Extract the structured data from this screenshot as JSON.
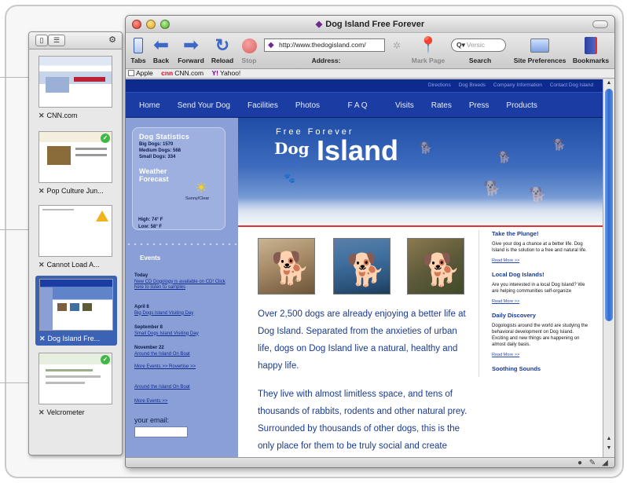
{
  "tabs_drawer": {
    "tabs": [
      {
        "label": "CNN.com",
        "status": "none"
      },
      {
        "label": "Pop Culture Jun...",
        "status": "check"
      },
      {
        "label": "Cannot Load A...",
        "status": "warning"
      },
      {
        "label": "Dog Island Fre...",
        "status": "none",
        "active": true
      },
      {
        "label": "Velcrometer",
        "status": "check"
      }
    ]
  },
  "window": {
    "title": "Dog Island Free Forever"
  },
  "toolbar": {
    "tabs_label": "Tabs",
    "back_label": "Back",
    "forward_label": "Forward",
    "reload_label": "Reload",
    "stop_label": "Stop",
    "address_label": "Address:",
    "address_value": "http://www.thedogisland.com/",
    "markpage_label": "Mark Page",
    "search_label": "Search",
    "search_prefix": "Q▾",
    "search_placeholder": "Versic",
    "siteprefs_label": "Site Preferences",
    "bookmarks_label": "Bookmarks"
  },
  "bookmarks_bar": {
    "items": [
      "Apple",
      "CNN.com",
      "Yahoo!"
    ]
  },
  "site": {
    "top_links": [
      "Directions",
      "Dog Breeds",
      "Company Information",
      "Contact Dog Island"
    ],
    "nav": [
      "Home",
      "Send Your Dog",
      "Facilities",
      "Photos",
      "F A Q",
      "Visits",
      "Rates",
      "Press",
      "Products"
    ],
    "stats_title": "Dog Statistics",
    "stats": [
      "Big Dogs: 1570",
      "Medium Dogs: 568",
      "Small Dogs: 334"
    ],
    "weather_title": "Weather Forecast",
    "weather_condition": "Sunny/Clear",
    "high": "High: 74° F",
    "low": "Low: 58° F",
    "events_title": "Events",
    "events": [
      {
        "date": "Today",
        "text": "New CD Dogology is available on CD! Click here to listen to samples"
      },
      {
        "date": "April 8",
        "text": "Big Dogs Island Visiting Day"
      },
      {
        "date": "September 8",
        "text": "Small Dogs Island Visiting Day"
      },
      {
        "date": "November 22",
        "text": "Around the Island On Boat"
      }
    ],
    "more_events": "More Events >> Rovertise >>",
    "extra_event": "Around the Island On Boat",
    "more_events_2": "More Events >>",
    "email_label": "your email:",
    "hero_tagline": "Free Forever",
    "hero_dog": "Dog",
    "hero_island": "Island",
    "body_1": "Over 2,500 dogs are already enjoying a better life at Dog Island. Separated from the anxieties of urban life, dogs on Dog Island live a natural, healthy and happy life.",
    "body_2": "They live with almost limitless space, and tens of thousands of rabbits, rodents and other natural prey. Surrounded by thousands of other dogs, this is the only place for them to be truly social and create healthy families.",
    "right_sections": [
      {
        "title": "Take the Plunge!",
        "text": "Give your dog a chance at a better life. Dog Island is the solution to a free and natural life.",
        "link": "Read More >>"
      },
      {
        "title": "Local Dog Islands!",
        "text": "Are you interested in a local Dog Island? We are helping communities self-organize",
        "link": "Read More >>"
      },
      {
        "title": "Daily Discovery",
        "text": "Dogologists around the world are studying the behavioral development on Dog Island. Exciting and new things are happening on almost daily basis.",
        "link": "Read More >>"
      },
      {
        "title": "Soothing Sounds",
        "text": "",
        "link": ""
      }
    ]
  },
  "colors": {
    "site_nav": "#1a3ca3",
    "site_sidebar": "#8a9fd5",
    "body_text": "#1a3a8f",
    "selection": "#3b62b4"
  }
}
